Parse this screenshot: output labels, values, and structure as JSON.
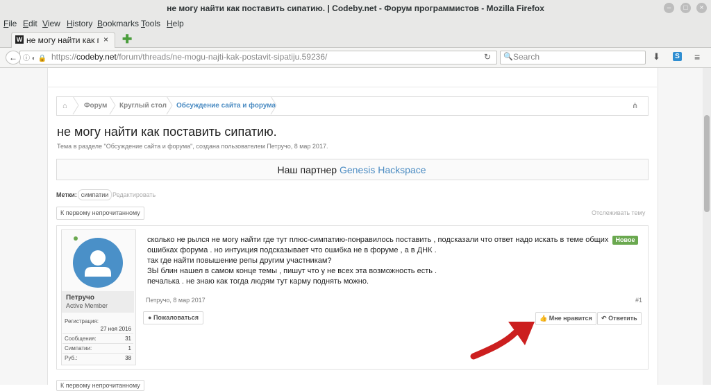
{
  "window": {
    "title": "не могу найти как поставить сипатию. | Codeby.net - Форум программистов - Mozilla Firefox"
  },
  "menubar": {
    "items": [
      {
        "label": "File",
        "accel": "F",
        "rest": "ile"
      },
      {
        "label": "Edit",
        "accel": "E",
        "rest": "dit"
      },
      {
        "label": "View",
        "accel": "V",
        "rest": "iew"
      },
      {
        "label": "History",
        "accel": "H",
        "rest": "istory"
      },
      {
        "label": "Bookmarks",
        "accel": "B",
        "rest": "ookmarks"
      },
      {
        "label": "Tools",
        "accel": "T",
        "rest": "ools"
      },
      {
        "label": "Help",
        "accel": "H",
        "rest": "elp"
      }
    ]
  },
  "tab": {
    "label": "не могу найти как поставить",
    "favicon": "W"
  },
  "navbar": {
    "url_prefix": "https://",
    "url_domain": "codeby.net",
    "url_path": "/forum/threads/ne-mogu-najti-kak-postavit-sipatiju.59236/",
    "search_placeholder": "Search"
  },
  "breadcrumb": {
    "items": [
      "Форум",
      "Круглый стол",
      "Обсуждение сайта и форума"
    ]
  },
  "thread": {
    "title": "не могу найти как поставить сипатию.",
    "meta": "Тема в разделе \"Обсуждение сайта и форума\", создана пользователем Петручо, 8 мар 2017."
  },
  "partner": {
    "prefix": "Наш партнер",
    "link": "Genesis Hackspace"
  },
  "tags": {
    "label": "Метки:",
    "tag": "симпатии",
    "edit": "Редактировать"
  },
  "controls": {
    "first_unread": "К первому непрочитанному",
    "watch": "Отслеживать тему"
  },
  "user": {
    "name": "Петручо",
    "title": "Active Member",
    "stats": {
      "registered_label": "Регистрация:",
      "registered_value": "27 ноя 2016",
      "messages_label": "Сообщения:",
      "messages_value": "31",
      "likes_label": "Симпатии:",
      "likes_value": "1",
      "rub_label": "Руб.:",
      "rub_value": "38"
    }
  },
  "post": {
    "lines": [
      "сколько не рылся не могу найти где тут плюс-симпатию-понравилось поставить , подсказали что ответ надо искать в теме общих",
      "ошибках форума . но интуиция подсказывает что ошибка не в форуме , а в ДНК .",
      "так где найти повышение репы другим участникам?",
      "ЗЫ блин нашел в самом конце темы , пишут что у не всех эта возможность есть .",
      "печалька . не знаю как тогда людям тут карму поднять можно."
    ],
    "badge": "Новое",
    "date": "Петручо, 8 мар 2017",
    "number": "#1",
    "report": "Пожаловаться",
    "like": "Мне нравится",
    "reply": "Ответить"
  },
  "colors": {
    "link": "#4a8bc2",
    "badge": "#6aa84f",
    "avatar": "#4a90c8",
    "arrow": "#cc1f1f"
  }
}
